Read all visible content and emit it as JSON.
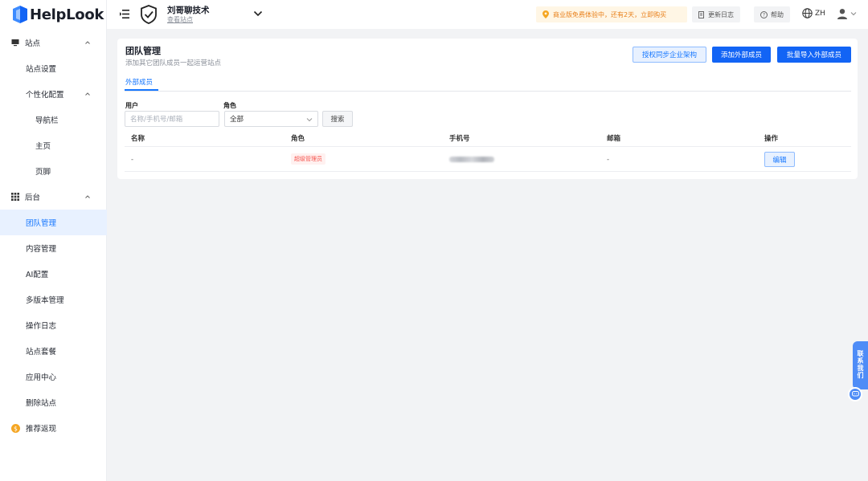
{
  "brand": {
    "name": "HelpLook"
  },
  "sidebar": {
    "groups": [
      {
        "label": "站点"
      },
      {
        "label": "后台"
      }
    ],
    "items": {
      "site_settings": "站点设置",
      "personalize": "个性化配置",
      "navbar": "导航栏",
      "homepage": "主页",
      "footer": "页脚",
      "team": "团队管理",
      "content": "内容管理",
      "ai": "AI配置",
      "versions": "多版本管理",
      "logs": "操作日志",
      "plans": "站点套餐",
      "apps": "应用中心",
      "delete_site": "删除站点",
      "referral": "推荐返现"
    },
    "active": "团队管理"
  },
  "header": {
    "site_name": "刘哥聊技术",
    "site_link": "查看站点",
    "promo": "商业版免费体验中，还有2天，立即购买",
    "changelog": "更新日志",
    "help": "帮助",
    "lang": "ZH"
  },
  "page": {
    "title": "团队管理",
    "subtitle": "添加其它团队成员一起运营站点",
    "buttons": {
      "sync": "授权同步企业架构",
      "add": "添加外部成员",
      "import": "批量导入外部成员"
    },
    "tab": "外部成员",
    "filters": {
      "user_label": "用户",
      "user_placeholder": "名称/手机号/邮箱",
      "role_label": "角色",
      "role_value": "全部",
      "search": "搜索"
    },
    "table": {
      "columns": [
        "名称",
        "角色",
        "手机号",
        "邮箱",
        "操作"
      ],
      "rows": [
        {
          "name": "-",
          "role": "超级管理员",
          "email": "-",
          "action": "编辑"
        }
      ]
    }
  },
  "contact": {
    "label": "联系我们"
  },
  "colors": {
    "primary": "#1264f5",
    "accent": "#1677ff",
    "warning": "#e8801b",
    "danger": "#f5544d"
  }
}
